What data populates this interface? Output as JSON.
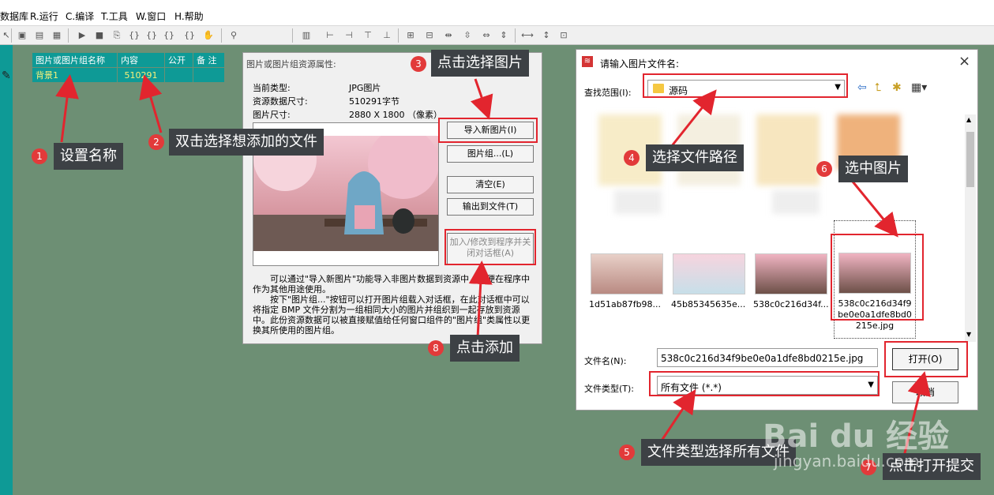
{
  "menu": {
    "items": [
      "数据库",
      "R.运行",
      "C.编译",
      "T.工具",
      "W.窗口",
      "H.帮助"
    ]
  },
  "resource_table": {
    "headers": [
      "图片或图片组名称",
      "内容",
      "公开",
      "备 注"
    ],
    "rows": [
      [
        "背景1",
        "510291",
        "",
        ""
      ]
    ]
  },
  "dialog1": {
    "title": "图片或图片组资源属性:",
    "current_type_label": "当前类型:",
    "current_type_value": "JPG图片",
    "data_size_label": "资源数据尺寸:",
    "data_size_value": "510291字节",
    "image_size_label": "图片尺寸:",
    "image_size_value": "2880 X 1800 （像素）",
    "buttons": {
      "import": "导入新图片(I)",
      "group": "图片组...(L)",
      "clear": "清空(E)",
      "export": "输出到文件(T)",
      "add_close": "加入/修改到程序并关闭对话框(A)"
    },
    "description_p1": "可以通过\"导入新图片\"功能导入非图片数据到资源中，以便在程序中作为其他用途使用。",
    "description_p2": "按下\"图片组...\"按钮可以打开图片组载入对话框，在此对话框中可以将指定 BMP 文件分割为一组相同大小的图片并组织到一起存放到资源中。此份资源数据可以被直接赋值给任何窗口组件的\"图片组\"类属性以更换其所使用的图片组。"
  },
  "dialog2": {
    "title": "请输入图片文件名:",
    "close_glyph": "×",
    "look_in_label": "查找范围(I):",
    "look_in_value": "源码",
    "files": [
      {
        "name": "1d51ab87fb98..."
      },
      {
        "name": "45b85345635e..."
      },
      {
        "name": "538c0c216d34f..."
      },
      {
        "name": "538c0c216d34f9be0e0a1dfe8bd0215e.jpg"
      }
    ],
    "filename_label": "文件名(N):",
    "filename_value": "538c0c216d34f9be0e0a1dfe8bd0215e.jpg",
    "filetype_label": "文件类型(T):",
    "filetype_value": "所有文件 (*.*)",
    "open_button": "打开(O)",
    "cancel_button": "取消"
  },
  "callouts": [
    {
      "num": "1",
      "text": "设置名称"
    },
    {
      "num": "2",
      "text": "双击选择想添加的文件"
    },
    {
      "num": "3",
      "text": "点击选择图片"
    },
    {
      "num": "4",
      "text": "选择文件路径"
    },
    {
      "num": "5",
      "text": "文件类型选择所有文件"
    },
    {
      "num": "6",
      "text": "选中图片"
    },
    {
      "num": "7",
      "text": "点击打开提交"
    },
    {
      "num": "8",
      "text": "点击添加"
    }
  ],
  "watermark": {
    "logo": "Bai du 经验",
    "url": "jingyan.baidu.com"
  },
  "colors": {
    "teal": "#0e9a96",
    "background": "#6d8f74",
    "callout": "#3d4145",
    "marker": "#e23a3a",
    "highlight": "#e2252e"
  }
}
